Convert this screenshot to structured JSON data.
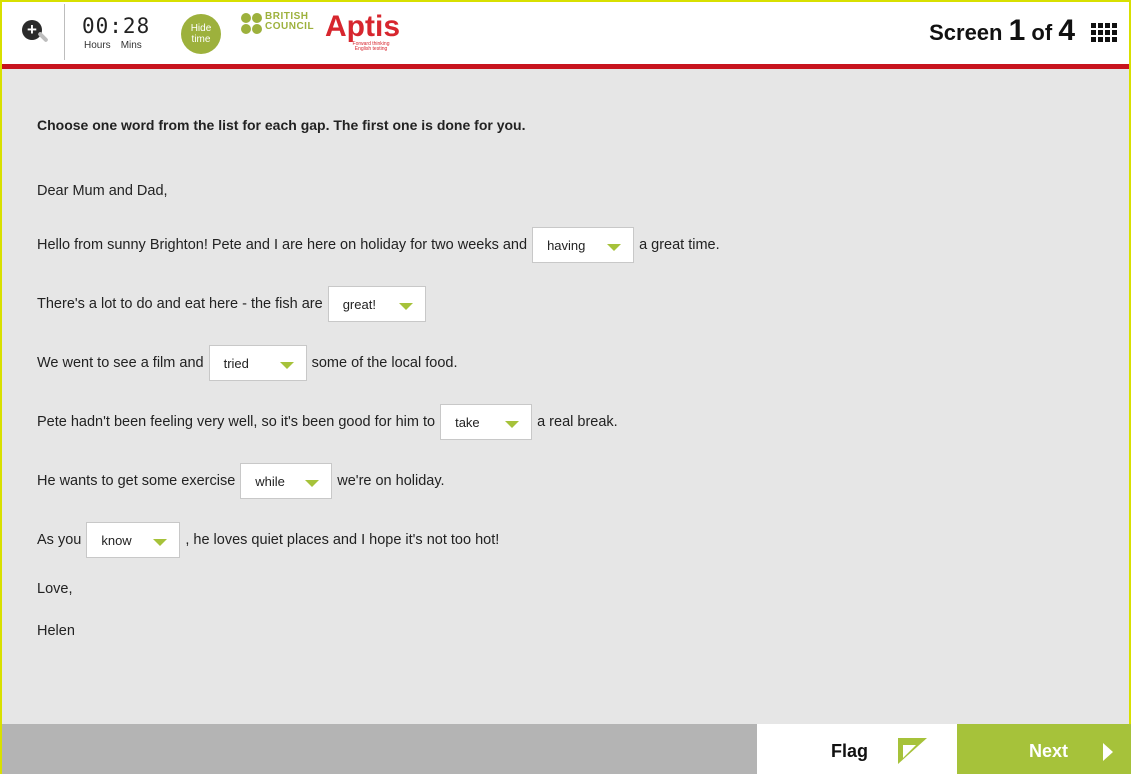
{
  "header": {
    "zoom_glyph": "+",
    "timer_value": "00:28",
    "timer_hours_label": "Hours",
    "timer_mins_label": "Mins",
    "hide_time_label": "Hide time",
    "logo_brand_line1": "BRITISH",
    "logo_brand_line2": "COUNCIL",
    "logo_product": "Aptis",
    "screen_prefix": "Screen",
    "screen_current": "1",
    "screen_of": "of",
    "screen_total": "4"
  },
  "task": {
    "instruction": "Choose one word from the list for each gap. The first one is done for you.",
    "greeting": "Dear Mum and Dad,",
    "lines": [
      {
        "before": "Hello from sunny Brighton! Pete and I are here on holiday for two weeks and",
        "selected": "having",
        "after": "a great time."
      },
      {
        "before": "There's a lot to do and eat here - the fish are",
        "selected": "great!",
        "after": ""
      },
      {
        "before": "We went to see a film and",
        "selected": "tried",
        "after": "some of the local food."
      },
      {
        "before": "Pete hadn't been feeling very well, so it's been good for him to",
        "selected": "take",
        "after": "a real break."
      },
      {
        "before": "He wants to get some exercise",
        "selected": "while",
        "after": "we're on holiday."
      },
      {
        "before": "As you",
        "selected": "know",
        "after": ", he loves quiet places and I hope it's not too hot!"
      }
    ],
    "closing": "Love,",
    "signature": "Helen"
  },
  "footer": {
    "flag_label": "Flag",
    "next_label": "Next"
  },
  "colors": {
    "accent_green": "#a6c23a",
    "header_red": "#c8141e",
    "frame_yellow": "#d8e000",
    "logo_red": "#d7262e"
  },
  "icons": {
    "zoom": "zoom-in-icon",
    "grid": "screen-grid-icon",
    "flag": "flag-icon",
    "next": "arrow-right-icon",
    "dropdown": "dropdown-arrow-icon"
  }
}
